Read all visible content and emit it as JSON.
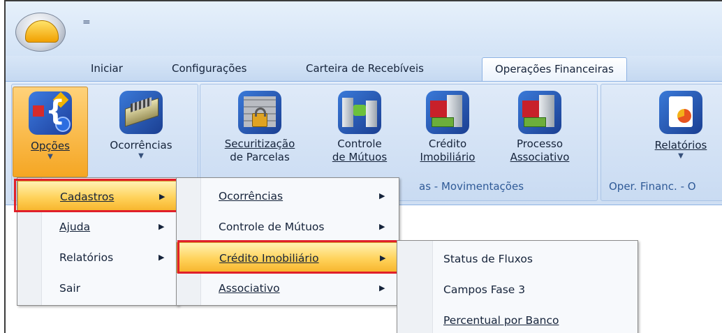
{
  "quick_access": {
    "symbol": "="
  },
  "tabs": [
    "Iniciar",
    "Configurações",
    "Carteira de Recebíveis",
    "Operações Financeiras"
  ],
  "ribbon": {
    "opcoes": {
      "label": "Opções",
      "icon": "options-icon"
    },
    "ocorrencias": {
      "label": "Ocorrências",
      "icon": "gears-icon"
    },
    "securitizacao": {
      "line1": "Securitização",
      "line2": "de Parcelas",
      "icon": "lock-wall-icon"
    },
    "controle": {
      "line1": "Controle",
      "line2": "de Mútuos",
      "icon": "buildings-transfer-icon"
    },
    "credito": {
      "line1": "Crédito",
      "line2": "Imobiliário",
      "icon": "house-money-icon"
    },
    "processo": {
      "line1": "Processo",
      "line2": "Associativo",
      "icon": "house-money-icon"
    },
    "relatorios": {
      "label": "Relatórios",
      "icon": "report-icon"
    },
    "group_labels": {
      "movimentacoes": "as - Movimentações",
      "oper_financ": "Oper. Financ. - O"
    }
  },
  "menu1": [
    {
      "label": "Cadastros"
    },
    {
      "label": "Ajuda"
    },
    {
      "label": "Relatórios"
    },
    {
      "label": "Sair"
    }
  ],
  "menu2": [
    {
      "label": "Ocorrências"
    },
    {
      "label": "Controle de Mútuos"
    },
    {
      "label": "Crédito Imobiliário"
    },
    {
      "label": "Associativo"
    }
  ],
  "menu3": [
    {
      "label": "Status de Fluxos"
    },
    {
      "label": "Campos Fase 3"
    },
    {
      "label": "Percentual por Banco"
    }
  ],
  "colors": {
    "highlight": "#ffd25a",
    "annotation_border": "#e0202a",
    "ribbon": "#d3e3f6"
  }
}
